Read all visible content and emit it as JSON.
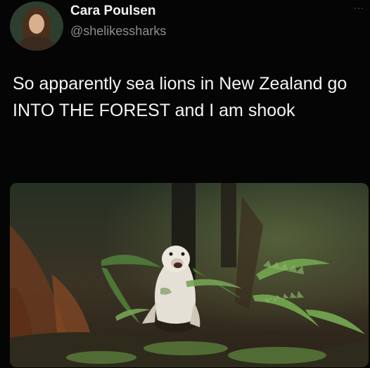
{
  "tweet": {
    "author": {
      "name": "Cara Poulsen",
      "handle": "@shelikessharks",
      "avatar_icon": "profile-photo"
    },
    "menu_icon": "more-horizontal-icon",
    "menu_glyph": "···",
    "text": "So apparently sea lions in New Zealand go INTO THE FOREST and I am shook",
    "media": {
      "type": "photo",
      "subject": "sea-lion-in-forest-photo"
    }
  }
}
